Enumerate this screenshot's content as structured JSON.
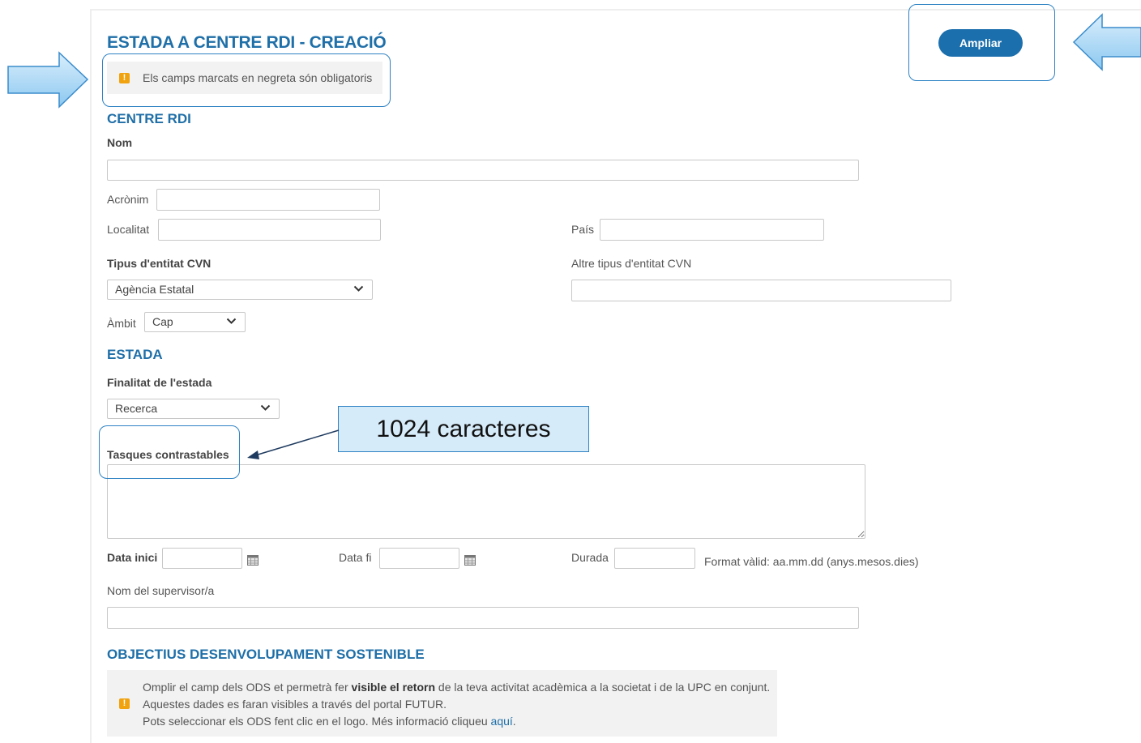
{
  "form": {
    "title": "ESTADA A CENTRE RDI - CREACIÓ",
    "required_notice": "Els camps marcats en negreta són obligatoris",
    "expand_button": "Ampliar"
  },
  "centre_section": {
    "title": "CENTRE RDI",
    "name_label": "Nom",
    "acronym_label": "Acrònim",
    "locality_label": "Localitat",
    "country_label": "País",
    "entity_type_label": "Tipus d'entitat CVN",
    "entity_type_value": "Agència Estatal",
    "other_entity_type_label": "Altre tipus d'entitat CVN",
    "scope_label": "Àmbit",
    "scope_value": "Cap"
  },
  "stay_section": {
    "title": "ESTADA",
    "purpose_label": "Finalitat de l'estada",
    "purpose_value": "Recerca",
    "tasks_label": "Tasques contrastables",
    "start_date_label": "Data inici",
    "end_date_label": "Data fi",
    "duration_label": "Durada",
    "duration_format": "Format vàlid: aa.mm.dd (anys.mesos.dies)",
    "supervisor_label": "Nom del supervisor/a"
  },
  "ods_section": {
    "title": "OBJECTIUS DESENVOLUPAMENT SOSTENIBLE",
    "line1_before": "Omplir el camp dels ODS et permetrà fer ",
    "line1_bold": "visible el retorn",
    "line1_after": " de la teva activitat acadèmica a la societat i de la UPC en conjunt.",
    "line2": "Aquestes dades es faran visibles a través del portal FUTUR.",
    "line3_before": "Pots seleccionar els ODS fent clic en el logo. Més informació cliqueu ",
    "line3_link": "aquí",
    "line3_after": "."
  },
  "annotation": {
    "char_limit_note": "1024 caracteres"
  },
  "colors": {
    "accent": "#1f6fa8",
    "button": "#1c6fad",
    "callout_border": "#2e82c4",
    "callout_fill": "#d6ebf9",
    "warning_icon": "#f1a20f"
  }
}
